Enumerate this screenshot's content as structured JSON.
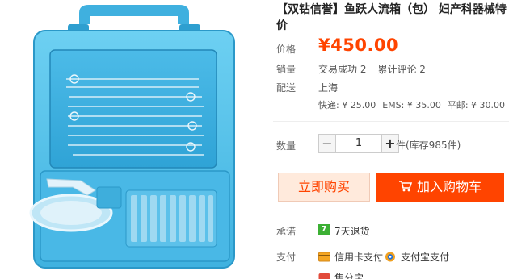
{
  "product": {
    "title": "【双钻信誉】鱼跃人流箱（包） 妇产科器械特价",
    "image_alt": "blue-surgical-instrument-case"
  },
  "price": {
    "label": "价格",
    "value": "¥450.00"
  },
  "sales": {
    "label": "销量",
    "deals": "交易成功 2",
    "reviews": "累计评论 2"
  },
  "delivery": {
    "label": "配送",
    "from": "上海",
    "express": "快递: ¥ 25.00",
    "ems": "EMS: ¥ 35.00",
    "post": "平邮: ¥ 30.00"
  },
  "quantity": {
    "label": "数量",
    "minus": "−",
    "value": "1",
    "plus": "+",
    "stock": "件(库存985件)"
  },
  "actions": {
    "buy_now": "立即购买",
    "add_to_cart": "加入购物车"
  },
  "promise": {
    "label": "承诺",
    "badge": "7",
    "text": "7天退货"
  },
  "payment": {
    "label": "支付",
    "credit_card": "信用卡支付",
    "alipay": "支付宝支付",
    "partial": "集分宝"
  },
  "colors": {
    "accent": "#ff4400",
    "price": "#ff4400",
    "case_blue": "#56c3ea",
    "badge_green": "#3cb034"
  }
}
